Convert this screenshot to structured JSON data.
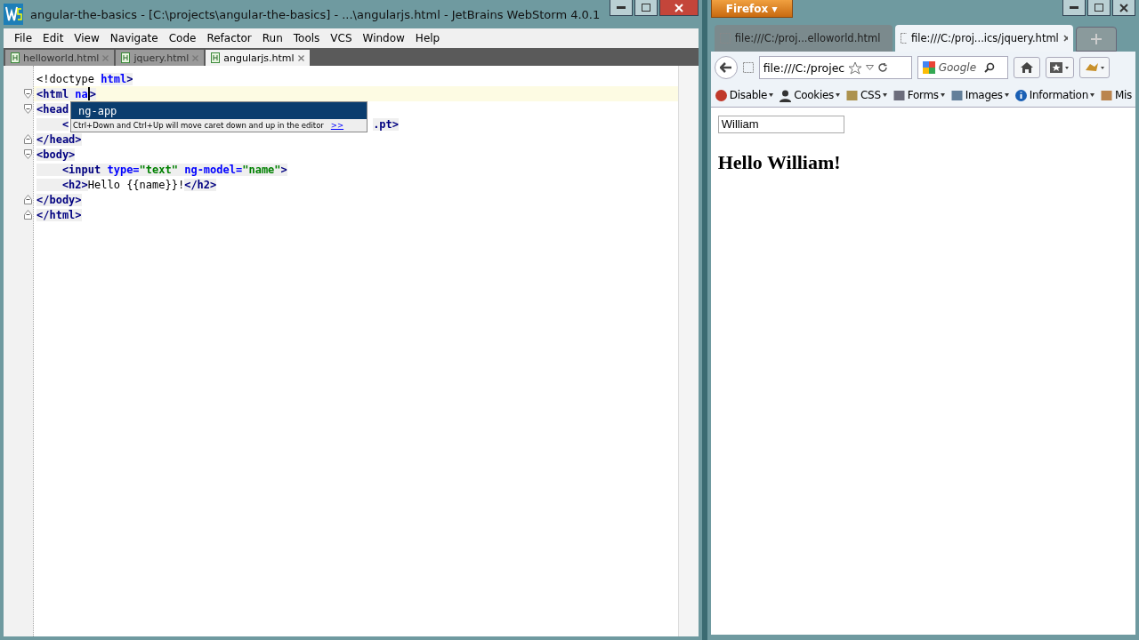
{
  "ide": {
    "title": "angular-the-basics - [C:\\projects\\angular-the-basics] - ...\\angularjs.html - JetBrains WebStorm 4.0.1",
    "menu": [
      "File",
      "Edit",
      "View",
      "Navigate",
      "Code",
      "Refactor",
      "Run",
      "Tools",
      "VCS",
      "Window",
      "Help"
    ],
    "tabs": [
      {
        "label": "helloworld.html",
        "selected": false
      },
      {
        "label": "jquery.html",
        "selected": false
      },
      {
        "label": "angularjs.html",
        "selected": true
      }
    ],
    "lines": [
      {
        "fold_start": false,
        "fold_end": false,
        "current": false,
        "tokens": [
          {
            "kind": "plain",
            "text": "<!doctype "
          },
          {
            "kind": "attr",
            "text": "html"
          },
          {
            "kind": "tag",
            "text": ">"
          }
        ]
      },
      {
        "fold_start": true,
        "fold_end": false,
        "current": true,
        "tokens": [
          {
            "kind": "tag",
            "text": "<html"
          },
          {
            "kind": "attr",
            "text": " na"
          },
          {
            "kind": "caret"
          },
          {
            "kind": "tag",
            "text": ">"
          }
        ]
      },
      {
        "fold_start": true,
        "fold_end": false,
        "current": false,
        "tokens": [
          {
            "kind": "tag",
            "text": "<head"
          }
        ]
      },
      {
        "fold_start": false,
        "fold_end": false,
        "current": false,
        "tokens": [
          {
            "kind": "tag",
            "text": "    <"
          },
          {
            "kind": "hidden"
          },
          {
            "kind": "tag",
            "text": ".pt>"
          }
        ]
      },
      {
        "fold_start": false,
        "fold_end": true,
        "current": false,
        "tokens": [
          {
            "kind": "tag",
            "text": "</head>"
          }
        ]
      },
      {
        "fold_start": true,
        "fold_end": false,
        "current": false,
        "tokens": [
          {
            "kind": "tag",
            "text": "<body>"
          }
        ]
      },
      {
        "fold_start": false,
        "fold_end": false,
        "current": false,
        "tokens": [
          {
            "kind": "tag",
            "text": "    <input"
          },
          {
            "kind": "attr",
            "text": " type="
          },
          {
            "kind": "value",
            "text": "\"text\""
          },
          {
            "kind": "attr",
            "text": " ng-model="
          },
          {
            "kind": "value",
            "text": "\"name\""
          },
          {
            "kind": "tag",
            "text": ">"
          }
        ]
      },
      {
        "fold_start": false,
        "fold_end": false,
        "current": false,
        "tokens": [
          {
            "kind": "tag",
            "text": "    <h2>"
          },
          {
            "kind": "plain",
            "text": "Hello {{name}}!"
          },
          {
            "kind": "tag",
            "text": "</h2>"
          }
        ]
      },
      {
        "fold_start": false,
        "fold_end": true,
        "current": false,
        "tokens": [
          {
            "kind": "tag",
            "text": "</body>"
          }
        ]
      },
      {
        "fold_start": false,
        "fold_end": true,
        "current": false,
        "tokens": [
          {
            "kind": "tag",
            "text": "</html>"
          }
        ]
      }
    ],
    "completion": {
      "items": [
        {
          "label": "ng-app",
          "selected": true
        }
      ],
      "hint": "Ctrl+Down and Ctrl+Up will move caret down and up in the editor",
      "hint_link": ">>"
    }
  },
  "browser": {
    "app_button": "Firefox ▾",
    "tabs": [
      {
        "label": "file:///C:/proj...elloworld.html",
        "selected": false
      },
      {
        "label": "file:///C:/proj...ics/jquery.html",
        "selected": true
      }
    ],
    "url": "file:///C:/projec",
    "search_placeholder": "Google",
    "toolbar": [
      {
        "label": "Disable",
        "kind": "disable"
      },
      {
        "label": "Cookies",
        "kind": "cookies"
      },
      {
        "label": "CSS",
        "kind": "css"
      },
      {
        "label": "Forms",
        "kind": "forms"
      },
      {
        "label": "Images",
        "kind": "images"
      },
      {
        "label": "Information",
        "kind": "info"
      },
      {
        "label": "Mis",
        "kind": "misc"
      }
    ],
    "page": {
      "input_value": "William",
      "heading": "Hello William!"
    }
  }
}
